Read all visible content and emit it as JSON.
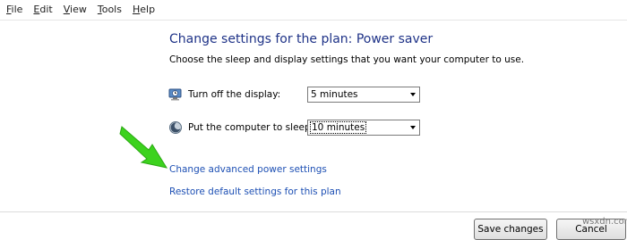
{
  "menubar": {
    "items": [
      {
        "first": "F",
        "rest": "ile"
      },
      {
        "first": "E",
        "rest": "dit"
      },
      {
        "first": "V",
        "rest": "iew"
      },
      {
        "first": "T",
        "rest": "ools"
      },
      {
        "first": "H",
        "rest": "elp"
      }
    ]
  },
  "main": {
    "title": "Change settings for the plan: Power saver",
    "subtitle": "Choose the sleep and display settings that you want your computer to use.",
    "display": {
      "label": "Turn off the display:",
      "value": "5 minutes",
      "icon": "monitor-clock-icon"
    },
    "sleep": {
      "label": "Put the computer to sleep:",
      "value": "10 minutes",
      "icon": "moon-sleep-icon"
    },
    "links": {
      "advanced": "Change advanced power settings",
      "restore": "Restore default settings for this plan"
    }
  },
  "footer": {
    "save_label": "Save changes",
    "cancel_label": "Cancel"
  },
  "watermark": "wsxdn.com",
  "colors": {
    "title": "#1e3287",
    "link": "#1e50b4",
    "arrow": "#3cd21e"
  }
}
